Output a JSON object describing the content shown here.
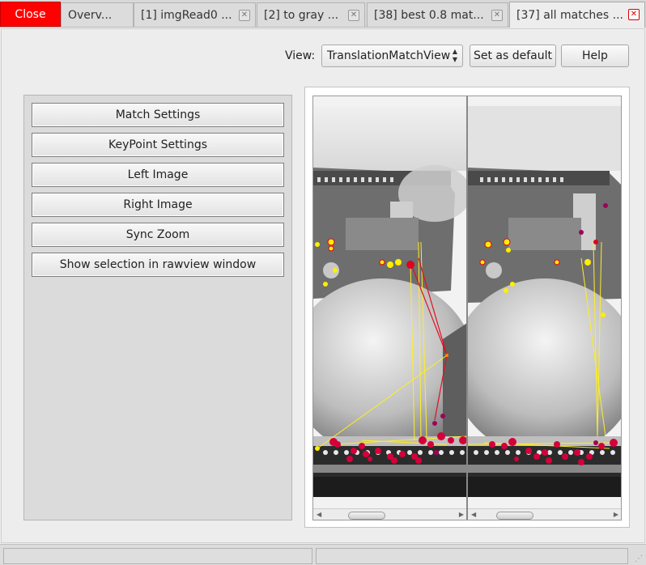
{
  "tabs": {
    "close_label": "Close",
    "items": [
      {
        "label": "Overv...",
        "closable": false
      },
      {
        "label": "[1] imgRead0   ...",
        "closable": true
      },
      {
        "label": "[2] to gray    ...",
        "closable": true
      },
      {
        "label": "[38] best 0.8 mat...",
        "closable": true
      },
      {
        "label": "[37] all matches ...",
        "closable": true,
        "active": true
      }
    ]
  },
  "toolbar": {
    "view_label": "View:",
    "view_value": "TranslationMatchView",
    "set_default_label": "Set as default",
    "help_label": "Help"
  },
  "settings": {
    "buttons": [
      "Match Settings",
      "KeyPoint Settings",
      "Left Image",
      "Right Image",
      "Sync Zoom",
      "Show selection in rawview window"
    ]
  },
  "colors": {
    "close_bg": "#ff0000",
    "keypoint_yellow": "#ffee00",
    "keypoint_red": "#e0002a",
    "keypoint_purple": "#a0005a",
    "match_line": "#ffee22"
  },
  "status": {
    "left": "",
    "right": ""
  }
}
